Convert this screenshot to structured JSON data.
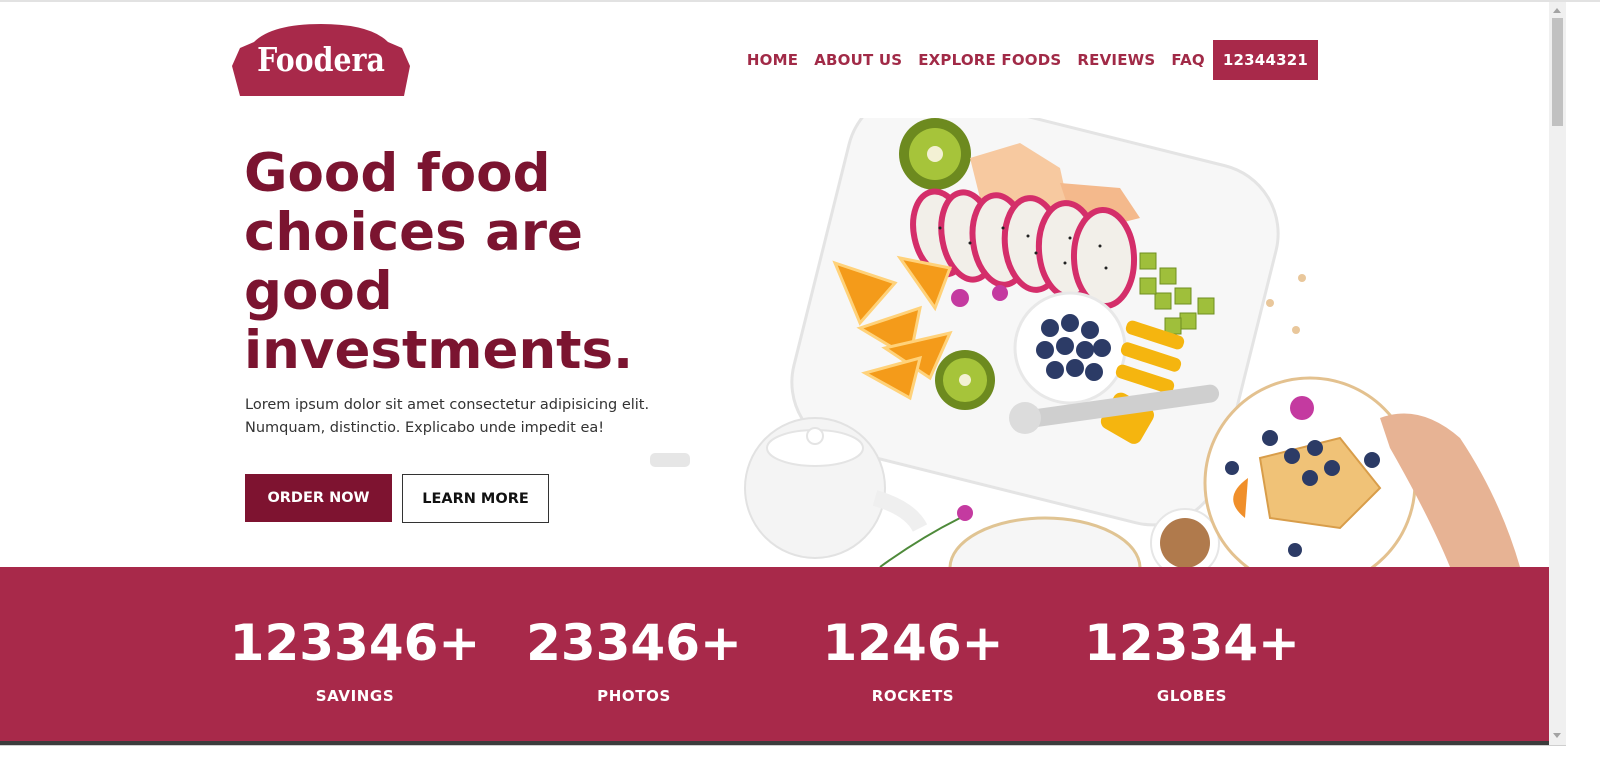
{
  "header": {
    "logo_text": "Foodera",
    "nav": [
      "HOME",
      "ABOUT US",
      "EXPLORE FOODS",
      "REVIEWS",
      "FAQ"
    ],
    "phone": "12344321"
  },
  "hero": {
    "title": "Good food choices are good investments.",
    "description": "Lorem ipsum dolor sit amet consectetur adipisicing elit. Numquam, distinctio. Explicabo unde impedit ea!",
    "order_button": "ORDER NOW",
    "learn_button": "LEARN MORE",
    "image_description": "Overhead photo of a platter of sliced fruit: dragon fruit, oranges, kiwi, blueberries and mango, with a white teapot and a plate of crepes"
  },
  "stats": [
    {
      "value": "123346+",
      "label": "SAVINGS"
    },
    {
      "value": "23346+",
      "label": "PHOTOS"
    },
    {
      "value": "1246+",
      "label": "ROCKETS"
    },
    {
      "value": "12334+",
      "label": "GLOBES"
    }
  ],
  "colors": {
    "brand": "#a8294a",
    "brand_dark": "#7b1430",
    "button_dark": "#7e1330"
  }
}
